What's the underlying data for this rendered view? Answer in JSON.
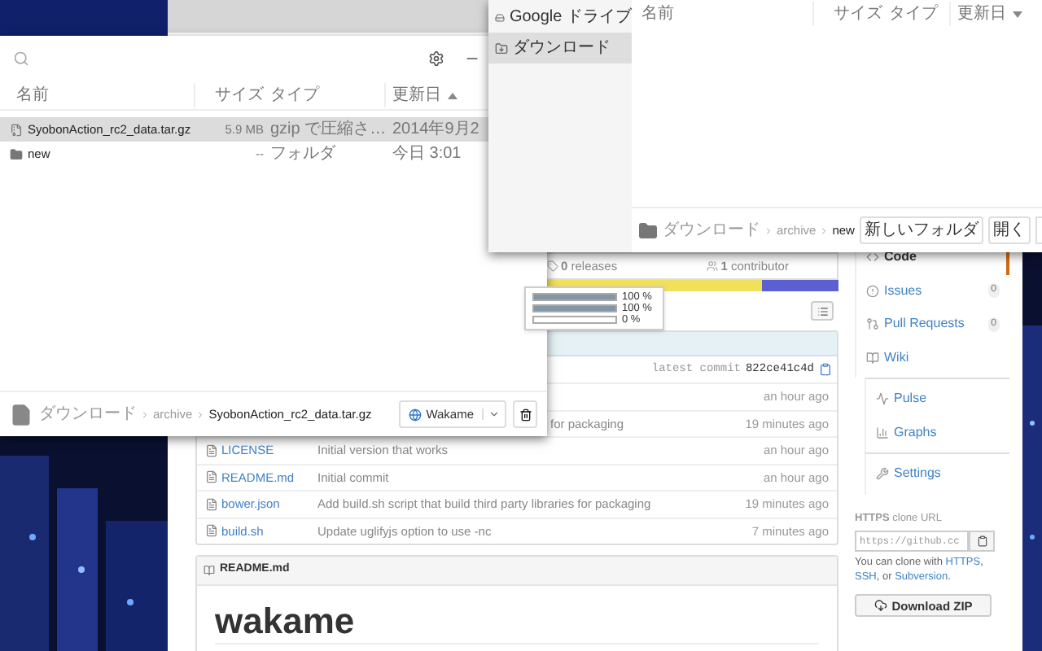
{
  "left_dialog": {
    "columns": [
      "名前",
      "サイズ",
      "タイプ",
      "更新日"
    ],
    "sort_ascending": true,
    "rows": [
      {
        "kind": "file",
        "name": "SyobonAction_rc2_data.tar.gz",
        "size": "5.9 MB",
        "type": "gzip で圧縮さ…",
        "modified": "2014年9月2",
        "selected": true
      },
      {
        "kind": "folder",
        "name": "new",
        "size": "--",
        "type": "フォルダ",
        "modified": "今日 3:01",
        "selected": false
      }
    ],
    "breadcrumb": [
      "ダウンロード",
      "archive",
      "SyobonAction_rc2_data.tar.gz"
    ],
    "account": "Wakame"
  },
  "right_dialog": {
    "sidebar": [
      {
        "label": "Google ドライブ",
        "selected": false
      },
      {
        "label": "ダウンロード",
        "selected": true
      }
    ],
    "columns": [
      "名前",
      "サイズ",
      "タイプ",
      "更新日"
    ],
    "sort_ascending": false,
    "breadcrumb": [
      "ダウンロード",
      "archive",
      "new"
    ],
    "buttons": [
      "新しいフォルダ",
      "開く"
    ]
  },
  "repo": {
    "stats": [
      "**0** releases",
      "**1** contributor"
    ],
    "languages": [
      {
        "color": "#f1e05a",
        "level": 0.88
      },
      {
        "color": "#5b5fd2",
        "level": 0.12
      }
    ],
    "tooltip": [
      {
        "level": 1,
        "reading": "100 %"
      },
      {
        "level": 1,
        "reading": "100 %"
      },
      {
        "level": 0,
        "reading": "0 %"
      }
    ],
    "latest_commit_label": "latest commit",
    "commit_id": "822ce41c4d",
    "files": [
      {
        "kind": "partial",
        "age": "an hour ago"
      },
      {
        "kind": "partial",
        "message": "for packaging",
        "age": "19 minutes ago"
      },
      {
        "kind": "file",
        "name": "LICENSE",
        "message": "Initial version that works",
        "age": "an hour ago"
      },
      {
        "kind": "file",
        "name": "README.md",
        "message": "Initial commit",
        "age": "an hour ago"
      },
      {
        "kind": "file",
        "name": "bower.json",
        "message": "Add build.sh script that build third party libraries for packaging",
        "age": "19 minutes ago"
      },
      {
        "kind": "file",
        "name": "build.sh",
        "message": "Update uglifyjs option to use -nc",
        "age": "7 minutes ago"
      }
    ],
    "readme": {
      "title": "README.md",
      "heading": "wakame"
    }
  },
  "nav": [
    [
      {
        "label": "Code",
        "selected": true
      },
      {
        "label": "Issues",
        "count": "0",
        "selected": false
      },
      {
        "label": "Pull Requests",
        "count": "0",
        "selected": false
      },
      {
        "label": "Wiki",
        "selected": false
      }
    ],
    [
      {
        "label": "Pulse",
        "selected": false
      },
      {
        "label": "Graphs",
        "selected": false
      }
    ],
    [
      {
        "label": "Settings",
        "selected": false
      }
    ]
  ],
  "clone": {
    "label": "**HTTPS** clone URL",
    "url": "https://github.cc",
    "help": [
      {
        "kind": "text",
        "text": "You can clone with "
      },
      {
        "kind": "link",
        "text": "HTTPS"
      },
      {
        "kind": "text",
        "text": ", "
      },
      {
        "kind": "link",
        "text": "SSH"
      },
      {
        "kind": "text",
        "text": ", or "
      },
      {
        "kind": "link",
        "text": "Subversion"
      },
      {
        "kind": "text",
        "text": "."
      }
    ],
    "download": "Download ZIP"
  }
}
